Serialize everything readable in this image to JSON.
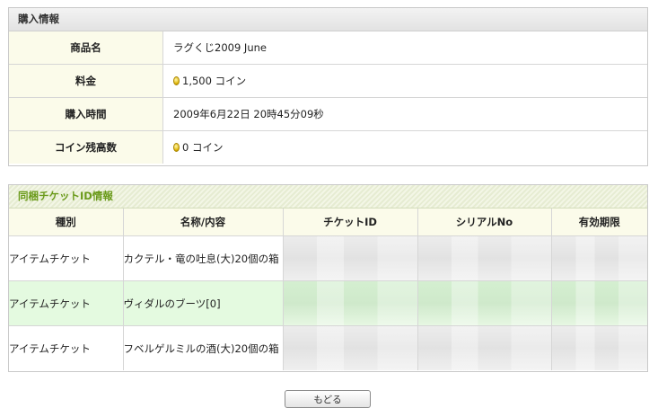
{
  "purchase": {
    "header": "購入情報",
    "rows": [
      {
        "label": "商品名",
        "value": "ラグくじ2009 June"
      },
      {
        "label": "料金",
        "value": "1,500 コイン",
        "icon": "coin-icon"
      },
      {
        "label": "購入時間",
        "value": "2009年6月22日 20時45分09秒"
      },
      {
        "label": "コイン残高数",
        "value": "0 コイン",
        "icon": "coin-icon"
      }
    ]
  },
  "tickets": {
    "header": "同梱チケットID情報",
    "columns": [
      "種別",
      "名称/内容",
      "チケットID",
      "シリアルNo",
      "有効期限"
    ],
    "rows": [
      {
        "type": "アイテムチケット",
        "name": "カクテル・竜の吐息(大)20個の箱"
      },
      {
        "type": "アイテムチケット",
        "name": "ヴィダルのブーツ[0]"
      },
      {
        "type": "アイテムチケット",
        "name": "フベルゲルミルの酒(大)20個の箱"
      }
    ]
  },
  "back_button": "もどる",
  "colors": {
    "ticket_header_text": "#6a9a1a",
    "label_bg": "#fbfbea",
    "highlight_row": "#e4fae0"
  }
}
